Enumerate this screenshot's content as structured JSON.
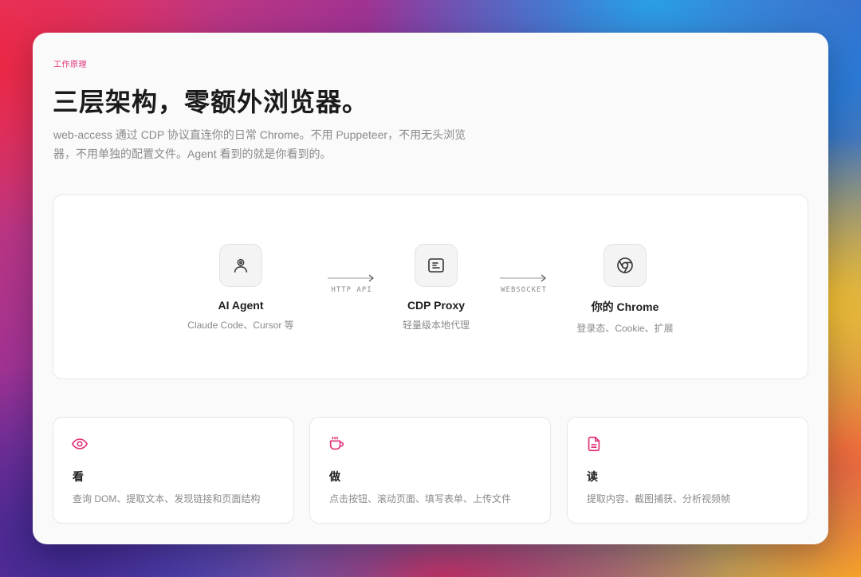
{
  "section": {
    "eyebrow": "工作原理",
    "headline": "三层架构，零额外浏览器。",
    "description": "web-access 通过 CDP 协议直连你的日常 Chrome。不用 Puppeteer，不用无头浏览器，不用单独的配置文件。Agent 看到的就是你看到的。"
  },
  "flow": {
    "nodes": [
      {
        "title": "AI Agent",
        "subtitle": "Claude Code、Cursor 等",
        "icon": "user-icon"
      },
      {
        "title": "CDP Proxy",
        "subtitle": "轻量级本地代理",
        "icon": "proxy-document-icon"
      },
      {
        "title": "你的 Chrome",
        "subtitle": "登录态、Cookie、扩展",
        "icon": "chrome-icon"
      }
    ],
    "connectors": [
      {
        "label": "HTTP API",
        "icon": "arrow-right-icon"
      },
      {
        "label": "WEBSOCKET",
        "icon": "arrow-right-icon"
      }
    ]
  },
  "features": [
    {
      "title": "看",
      "description": "查询 DOM、提取文本、发现链接和页面结构",
      "icon": "eye-icon"
    },
    {
      "title": "做",
      "description": "点击按钮、滚动页面、填写表单、上传文件",
      "icon": "cup-icon"
    },
    {
      "title": "读",
      "description": "提取内容、截图捕获、分析视频帧",
      "icon": "file-text-icon"
    }
  ],
  "colors": {
    "accent": "#e0337a",
    "card_background": "#fafafa",
    "text_primary": "#1a1a1a",
    "text_secondary": "#8a8a8a"
  }
}
